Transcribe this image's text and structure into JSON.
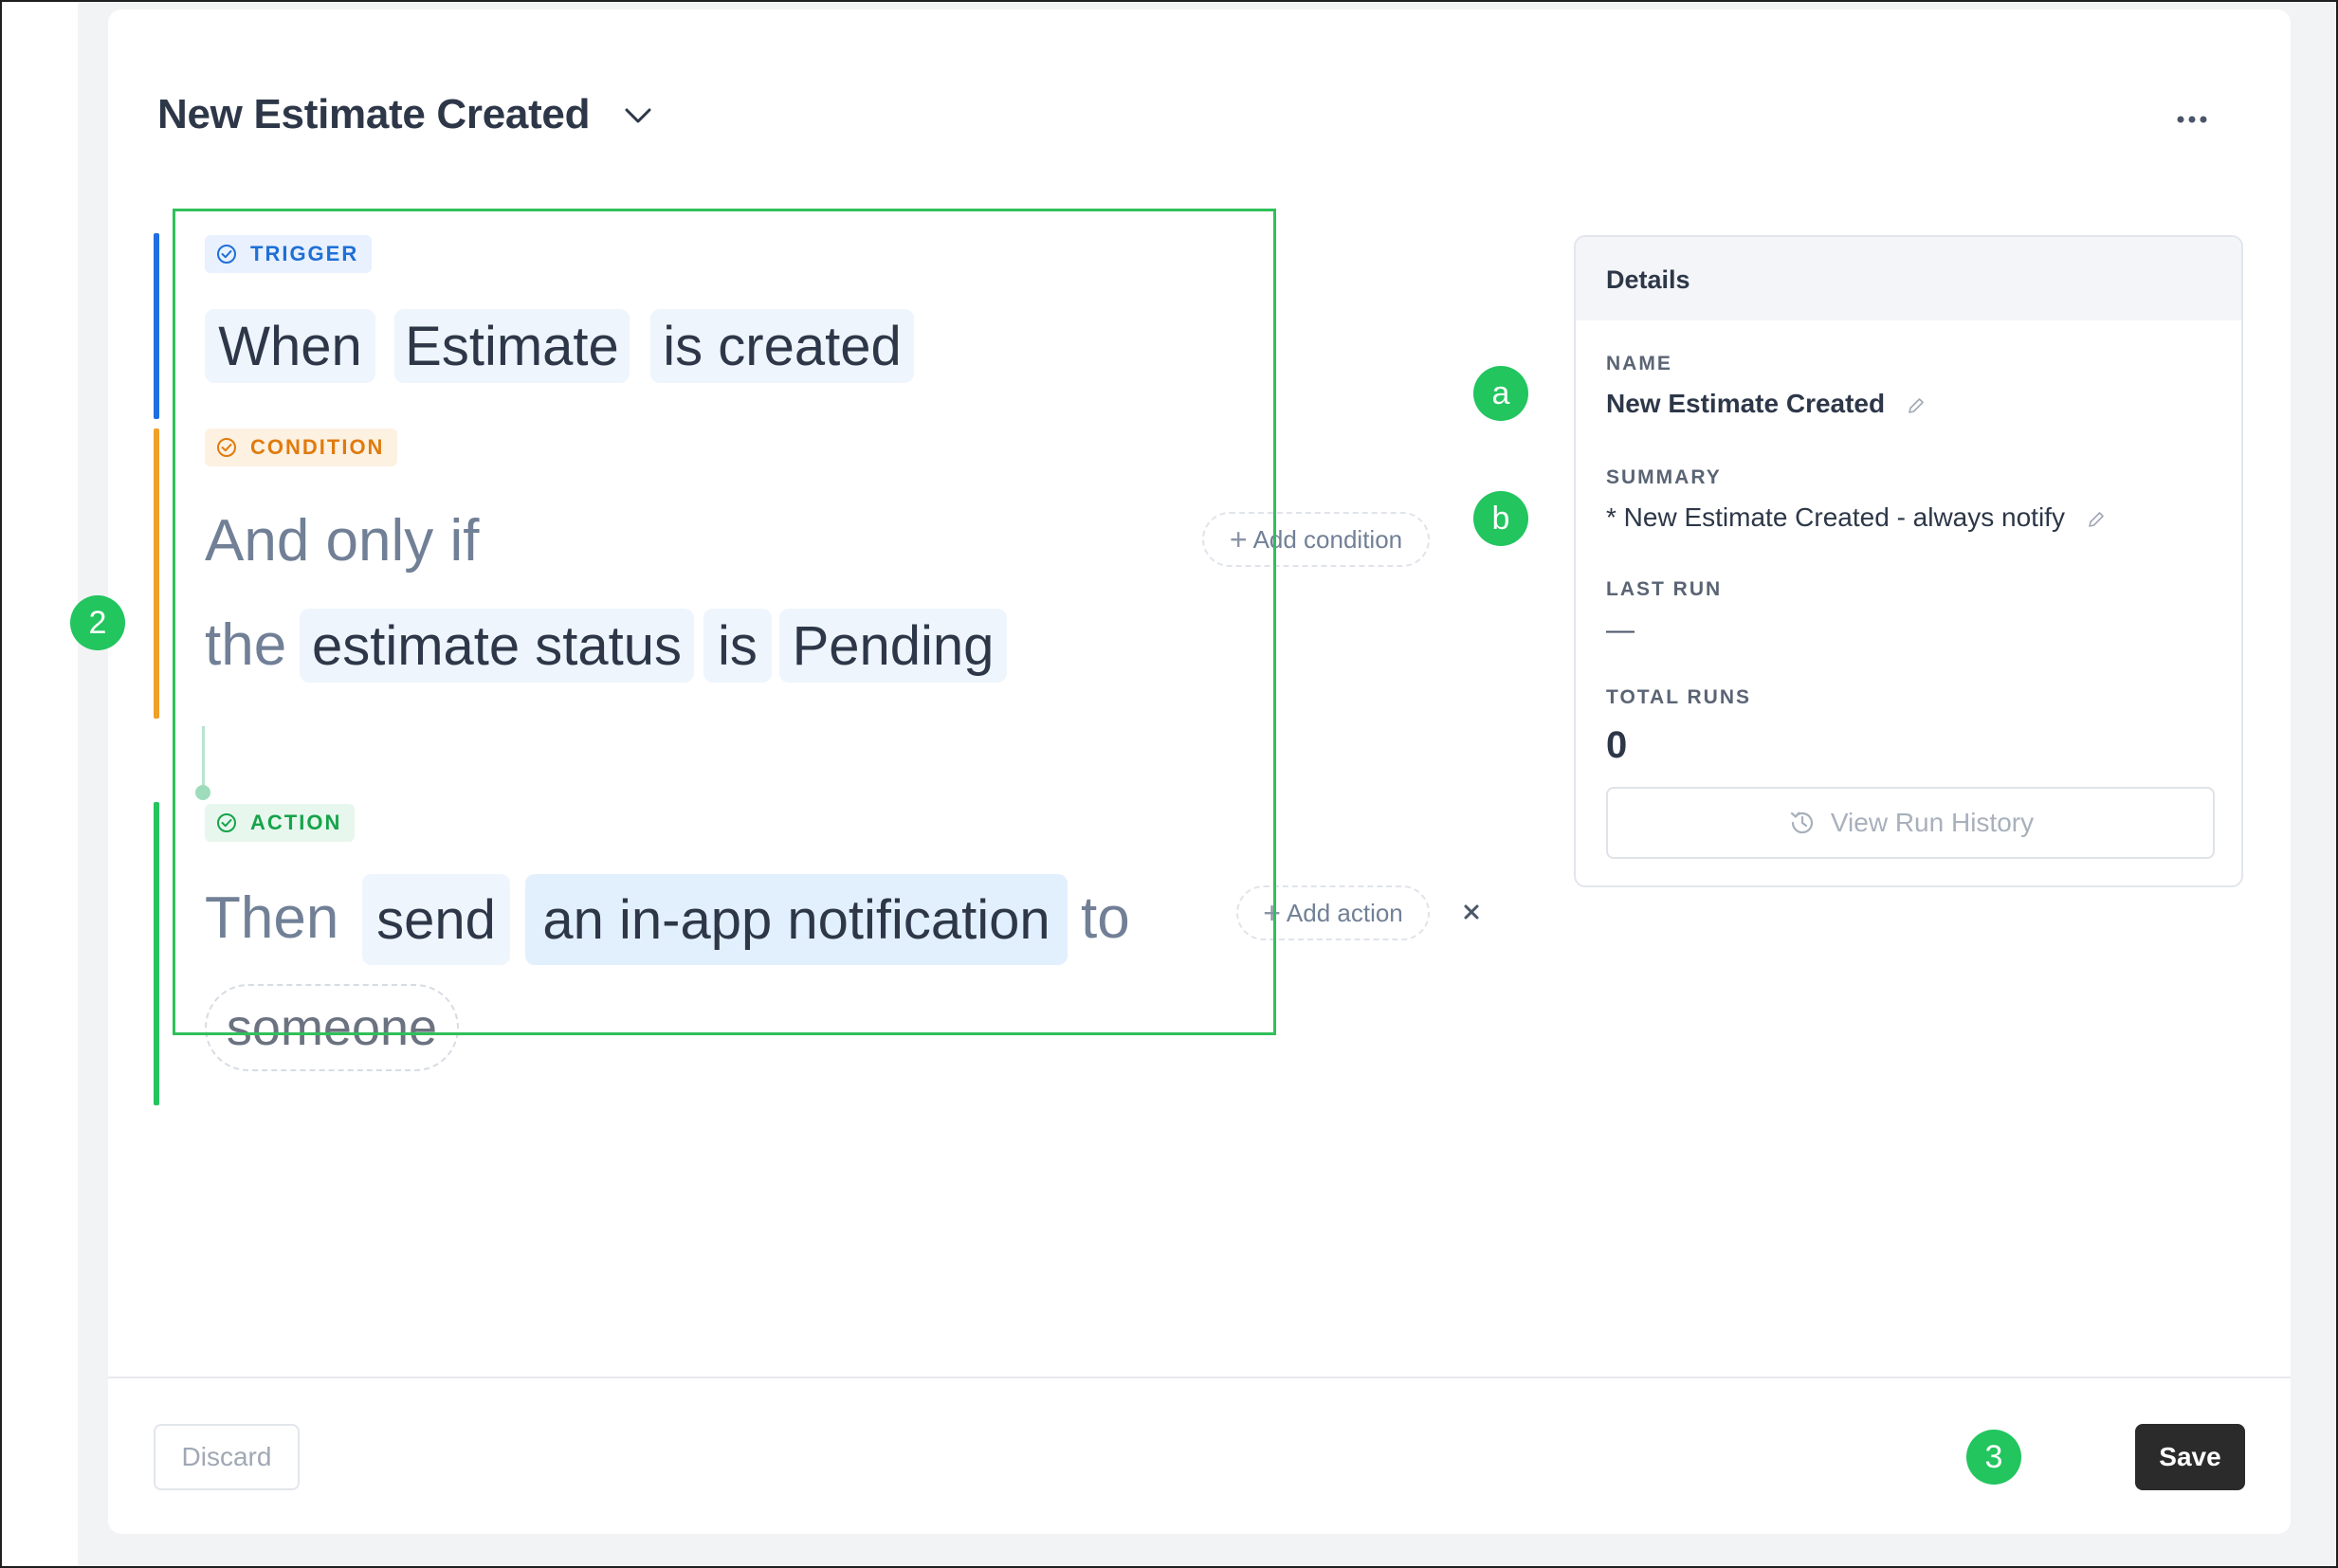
{
  "header": {
    "title": "New Estimate Created"
  },
  "trigger": {
    "badge": "TRIGGER",
    "tokens": [
      "When",
      "Estimate",
      "is created"
    ]
  },
  "condition": {
    "badge": "CONDITION",
    "lead": "And only if",
    "the": "the",
    "tokens": [
      "estimate status",
      "is",
      "Pending"
    ],
    "add_label": "Add condition"
  },
  "action": {
    "badge": "ACTION",
    "lead": "Then",
    "tokens": [
      "send",
      "an in-app notification"
    ],
    "to": "to",
    "recipient": "someone",
    "add_label": "Add action"
  },
  "details": {
    "title": "Details",
    "name_label": "NAME",
    "name_value": "New Estimate Created",
    "summary_label": "SUMMARY",
    "summary_value": "* New Estimate Created - always notify",
    "last_run_label": "LAST RUN",
    "last_run_value": "—",
    "total_runs_label": "TOTAL RUNS",
    "total_runs_value": "0",
    "history_button": "View Run History"
  },
  "footer": {
    "discard": "Discard",
    "save": "Save"
  },
  "markers": {
    "m2": "2",
    "ma": "a",
    "mb": "b",
    "m3": "3"
  },
  "colors": {
    "trigger": "#1e6fe0",
    "condition": "#f0a029",
    "action": "#22c55e",
    "annotation": "#22c55e",
    "save_button": "#2b2b2b"
  },
  "icons": [
    "chevron-down-icon",
    "more-horizontal-icon",
    "check-circle-icon",
    "plus-icon",
    "close-icon",
    "pencil-icon",
    "history-icon"
  ]
}
